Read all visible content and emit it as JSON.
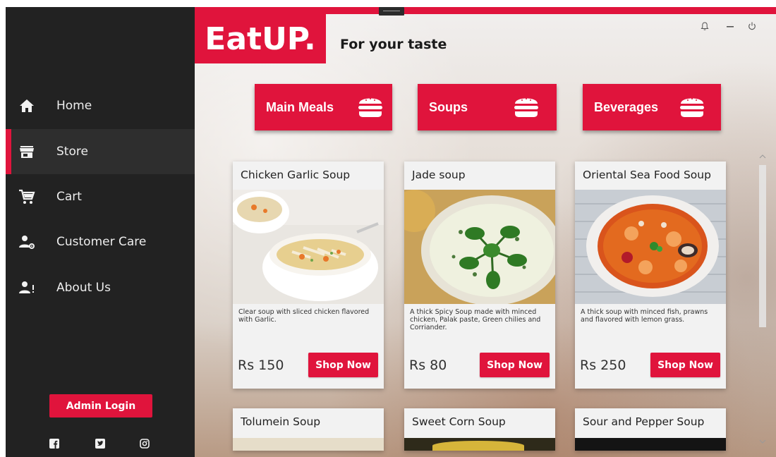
{
  "app": {
    "logo": "EatUP.",
    "tagline": "For your taste"
  },
  "sidebar": {
    "items": [
      {
        "label": "Home",
        "icon": "home-icon"
      },
      {
        "label": "Store",
        "icon": "store-icon",
        "active": true
      },
      {
        "label": "Cart",
        "icon": "cart-icon"
      },
      {
        "label": "Customer Care",
        "icon": "customer-care-icon"
      },
      {
        "label": "About Us",
        "icon": "about-us-icon"
      }
    ],
    "admin_login": "Admin Login",
    "social": [
      "facebook-icon",
      "twitter-icon",
      "instagram-icon"
    ]
  },
  "window_controls": [
    "bell-icon",
    "minimize-icon",
    "power-icon"
  ],
  "categories": [
    {
      "label": "Main Meals",
      "icon": "burger-icon"
    },
    {
      "label": "Soups",
      "icon": "burger-icon"
    },
    {
      "label": "Beverages",
      "icon": "burger-icon"
    }
  ],
  "products": [
    {
      "title": "Chicken Garlic Soup",
      "description": "Clear soup with sliced chicken flavored with Garlic.",
      "price": "Rs 150",
      "button": "Shop Now"
    },
    {
      "title": "Jade soup",
      "description": "A thick Spicy Soup made with minced chicken, Palak paste, Green chilies and Corriander.",
      "price": "Rs 80",
      "button": "Shop Now"
    },
    {
      "title": "Oriental Sea Food Soup",
      "description": "A thick soup with minced fish, prawns and flavored with  lemon grass.",
      "price": "Rs 250",
      "button": "Shop Now"
    }
  ],
  "more_products": [
    {
      "title": "Tolumein Soup"
    },
    {
      "title": "Sweet Corn Soup"
    },
    {
      "title": "Sour and Pepper Soup"
    }
  ],
  "colors": {
    "accent": "#e0143c",
    "sidebar": "#222222",
    "card": "#f2f2f2"
  }
}
